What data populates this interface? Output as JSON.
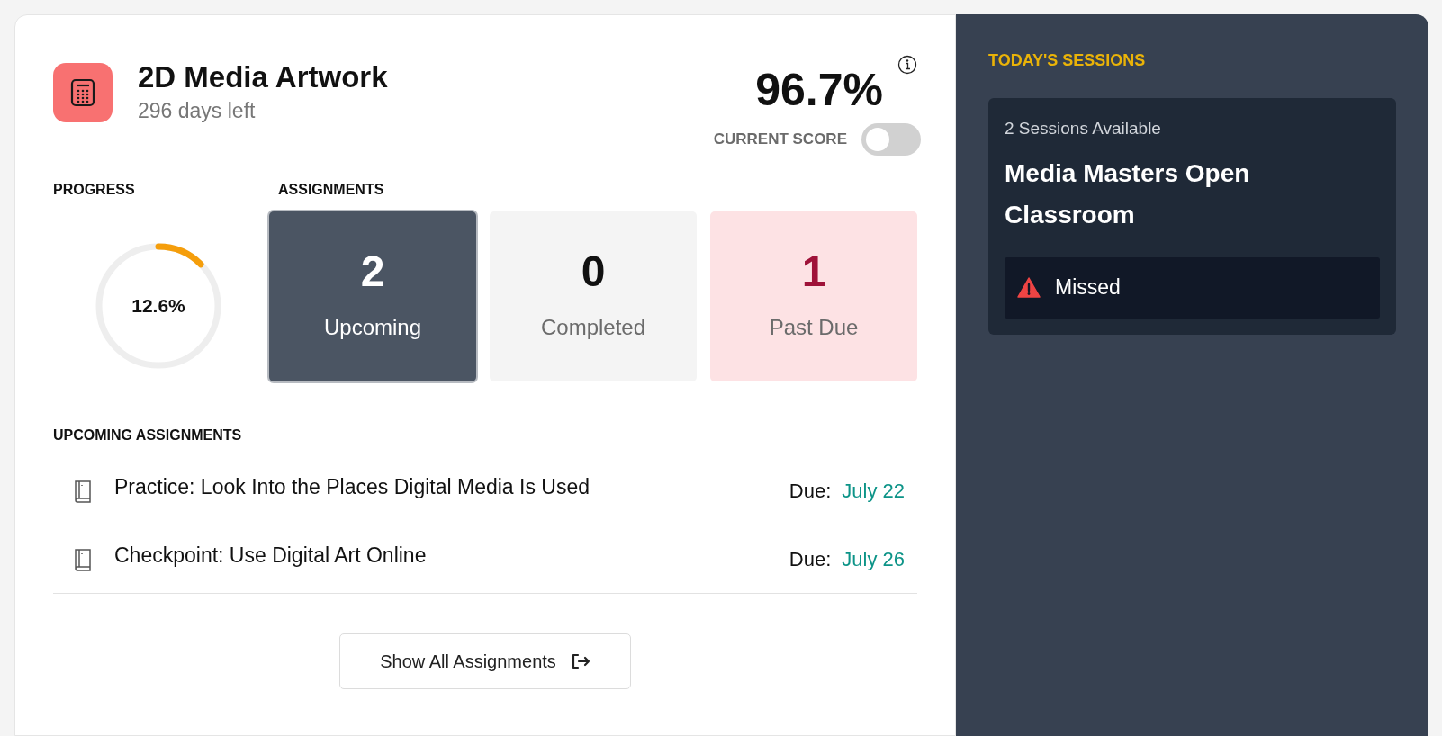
{
  "course": {
    "title": "2D Media Artwork",
    "subtitle": "296 days left",
    "score": "96.7%",
    "score_label": "CURRENT SCORE",
    "score_toggle_on": false
  },
  "progress": {
    "heading": "PROGRESS",
    "level": 0.126,
    "reading": "12.6%"
  },
  "assignments": {
    "heading": "ASSIGNMENTS",
    "tiles": [
      {
        "kind": "upcoming",
        "count": "2",
        "label": "Upcoming",
        "selected": true
      },
      {
        "kind": "completed",
        "count": "0",
        "label": "Completed",
        "selected": false
      },
      {
        "kind": "past_due",
        "count": "1",
        "label": "Past Due",
        "selected": false
      }
    ]
  },
  "upcoming": {
    "heading": "UPCOMING ASSIGNMENTS",
    "items": [
      {
        "title": "Practice: Look Into the Places Digital Media Is Used",
        "due_label": "Due:",
        "due_date": "July 22"
      },
      {
        "title": "Checkpoint: Use Digital Art Online",
        "due_label": "Due:",
        "due_date": "July 26"
      }
    ],
    "button": "Show All Assignments"
  },
  "sessions": {
    "heading": "TODAY'S SESSIONS",
    "card": {
      "count": "2 Sessions Available",
      "title": "Media Masters Open Classroom",
      "status": "Missed"
    }
  }
}
